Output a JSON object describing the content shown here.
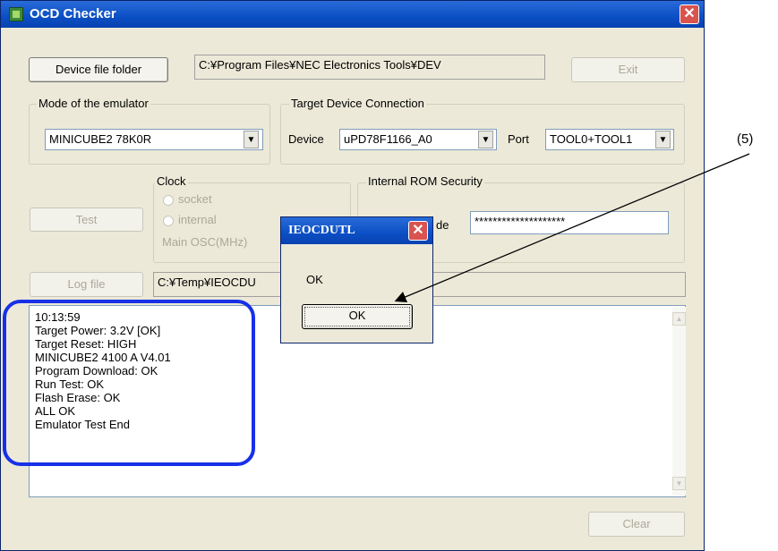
{
  "window": {
    "title": "OCD Checker",
    "icon": "chip-icon",
    "close_glyph": "✕"
  },
  "top_row": {
    "device_file_folder_label": "Device file folder",
    "device_path": "C:¥Program Files¥NEC Electronics Tools¥DEV",
    "exit_label": "Exit"
  },
  "mode_group": {
    "legend": "Mode of the emulator",
    "selected": "MINICUBE2 78K0R"
  },
  "target_group": {
    "legend": "Target Device Connection",
    "device_label": "Device",
    "device_value": "uPD78F1166_A0",
    "port_label": "Port",
    "port_value": "TOOL0+TOOL1"
  },
  "test_button_label": "Test",
  "clock_group": {
    "legend": "Clock",
    "option_socket": "socket",
    "option_internal": "internal",
    "main_osc_label": "Main OSC(MHz)"
  },
  "rom_security_group": {
    "legend": "Internal ROM Security",
    "code_label_partial": "de",
    "code_value": "********************"
  },
  "log_row": {
    "log_file_label": "Log file",
    "log_path": "C:¥Temp¥IEOCDU"
  },
  "log_output": {
    "lines": [
      "10:13:59",
      "Target Power: 3.2V [OK]",
      "Target Reset: HIGH",
      "MINICUBE2 4100 A V4.01",
      "Program Download: OK",
      "Run Test:  OK",
      "Flash Erase: OK",
      "ALL OK",
      "Emulator Test End"
    ]
  },
  "clear_label": "Clear",
  "dialog": {
    "title": "IEOCDUTL",
    "message": "OK",
    "ok_label": "OK"
  },
  "annotation": {
    "callout_label": "(5)",
    "highlight_color": "#1730e8"
  },
  "colors": {
    "titlebar_blue": "#0a4fc4",
    "window_face": "#ece9d8",
    "close_red": "#d9534f"
  }
}
